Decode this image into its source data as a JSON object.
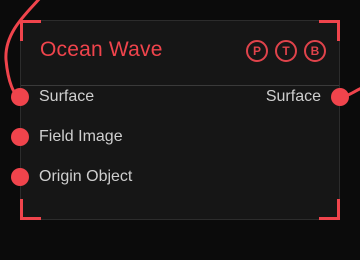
{
  "node": {
    "title": "Ocean Wave",
    "badges": [
      "P",
      "T",
      "B"
    ],
    "accent_color": "#f0444c",
    "inputs": [
      "Surface",
      "Field Image",
      "Origin Object"
    ],
    "outputs": [
      "Surface"
    ]
  }
}
